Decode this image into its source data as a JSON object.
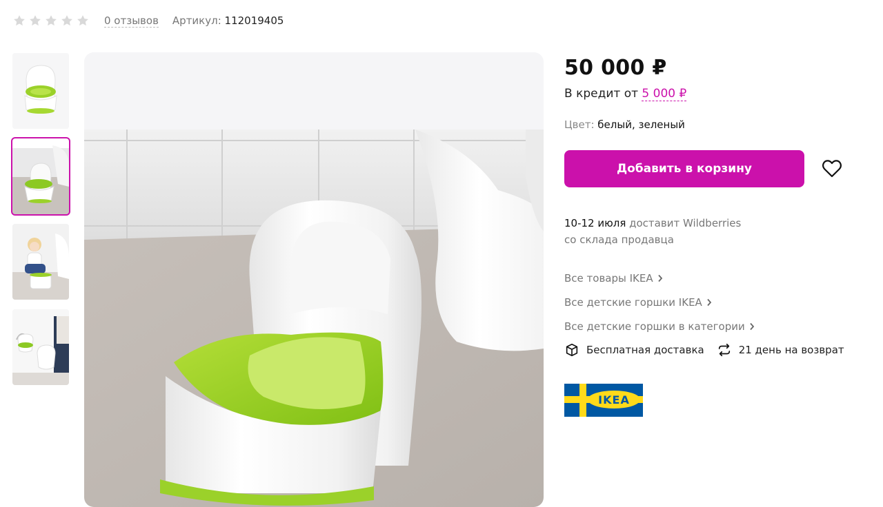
{
  "rating": {
    "stars_filled": 0,
    "stars_total": 5,
    "reviews_text": "0 отзывов"
  },
  "sku": {
    "label": "Артикул:",
    "value": "112019405"
  },
  "price": {
    "value": "50 000 ₽",
    "credit_prefix": "В кредит от",
    "credit_amount": "5 000 ₽"
  },
  "color": {
    "label": "Цвет:",
    "value": "белый, зеленый"
  },
  "cart": {
    "add_label": "Добавить в корзину"
  },
  "delivery": {
    "date": "10-12 июля",
    "by": "доставит Wildberries",
    "source": "со склада продавца"
  },
  "links": [
    {
      "label": "Все товары IKEA"
    },
    {
      "label": "Все детские горшки IKEA"
    },
    {
      "label": "Все детские горшки в категории"
    }
  ],
  "features": {
    "free_delivery": "Бесплатная доставка",
    "returns": "21 день на возврат"
  },
  "brand": {
    "logo_text": "IKEA"
  },
  "thumbnails": {
    "count": 4,
    "active_index": 1
  },
  "colors": {
    "accent": "#cb11ab",
    "price": "#111111",
    "muted": "#777777",
    "ikea_blue": "#0058a3",
    "ikea_yellow": "#ffda1a"
  }
}
